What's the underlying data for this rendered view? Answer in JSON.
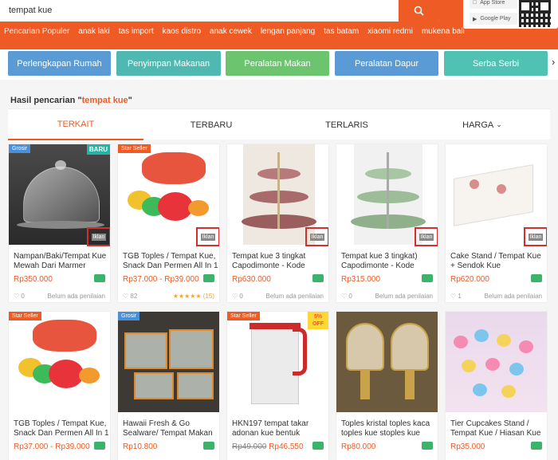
{
  "search": {
    "value": "tempat kue"
  },
  "app_badges": {
    "app_store": "App Store",
    "google_play": "Google Play"
  },
  "popular": {
    "label": "Pencarian Populer",
    "items": [
      "anak laki",
      "tas import",
      "kaos distro",
      "anak cewek",
      "lengan panjang",
      "tas batam",
      "xiaomi redmi",
      "mukena bali"
    ]
  },
  "categories": [
    {
      "label": "Perlengkapan Rumah",
      "color": "#5a9bd5"
    },
    {
      "label": "Penyimpan Makanan",
      "color": "#4fb8b0"
    },
    {
      "label": "Peralatan Makan",
      "color": "#6cc46f"
    },
    {
      "label": "Peralatan Dapur",
      "color": "#5a9bd5"
    },
    {
      "label": "Serba Serbi",
      "color": "#4fc2b3"
    }
  ],
  "results": {
    "prefix": "Hasil pencarian \"",
    "query": "tempat kue",
    "suffix": "\""
  },
  "tabs": [
    "TERKAIT",
    "TERBARU",
    "TERLARIS",
    "HARGA"
  ],
  "accent": "#ef5b25",
  "products": [
    {
      "name": "Nampan/Baki/Tempat Kue Mewah Dari Marmer",
      "price": "Rp350.000",
      "likes": "0",
      "rating": "Belum ada penilaian",
      "badge": "Grosir",
      "baru": "BARU",
      "ad": "Iklan"
    },
    {
      "name": "TGB Toples / Tempat Kue, Snack Dan Permen All In 1",
      "price": "Rp37.000 - Rp39.000",
      "likes": "82",
      "rating": "★★★★★ (15)",
      "badge": "Star Seller",
      "ad": "Iklan"
    },
    {
      "name": "Tempat kue 3 tingkat Capodimonte - Kode",
      "price": "Rp630.000",
      "likes": "0",
      "rating": "Belum ada penilaian",
      "ad": "Iklan"
    },
    {
      "name": "Tempat kue 3 tingkat) Capodimonte - Kode",
      "price": "Rp315.000",
      "likes": "0",
      "rating": "Belum ada penilaian",
      "ad": "Iklan"
    },
    {
      "name": "Cake Stand / Tempat Kue + Sendok Kue",
      "price": "Rp620.000",
      "likes": "1",
      "rating": "Belum ada penilaian",
      "ad": "Iklan"
    },
    {
      "name": "TGB Toples / Tempat Kue, Snack Dan Permen All In 1",
      "price": "Rp37.000 - Rp39.000",
      "badge": "Star Seller"
    },
    {
      "name": "Hawaii Fresh & Go Sealware/ Tempat Makan",
      "price": "Rp10.800",
      "badge": "Grosir"
    },
    {
      "name": "HKN197 tempat takar adonan kue bentuk",
      "old_price": "Rp49.000",
      "price": "Rp46.550",
      "badge": "Star Seller",
      "off": "5% OFF"
    },
    {
      "name": "Toples kristal toples kaca toples kue stoples kue",
      "price": "Rp80.000"
    },
    {
      "name": "Tier Cupcakes Stand / Tempat Kue / Hiasan Kue",
      "price": "Rp35.000"
    }
  ]
}
